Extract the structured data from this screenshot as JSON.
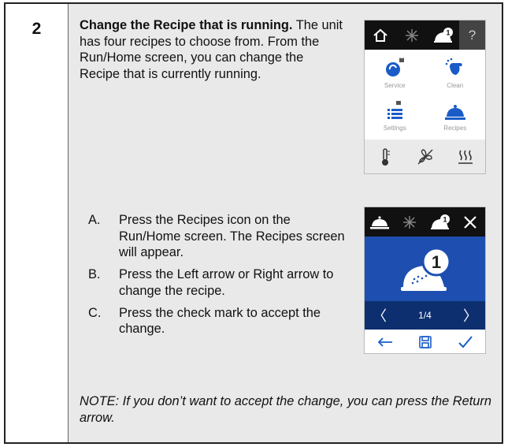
{
  "step_number": "2",
  "intro": {
    "title": "Change the Recipe that is running.",
    "body": " The unit has four recipes to choose from. From the Run/Home screen, you can change the Recipe that is currently running."
  },
  "steps": [
    {
      "letter": "A.",
      "text": "Press the Recipes icon on the Run/Home screen. The Recipes screen will appear."
    },
    {
      "letter": "B.",
      "text": "Press the Left arrow or Right arrow to change the recipe."
    },
    {
      "letter": "C.",
      "text": "Press the check mark to accept the change."
    }
  ],
  "note": "NOTE: If you don’t want to accept the change, you can press the Return arrow.",
  "home_screen": {
    "help_label": "?",
    "tiles": [
      {
        "label": "Service",
        "icon": "service-icon"
      },
      {
        "label": "Clean",
        "icon": "clean-icon"
      },
      {
        "label": "Settings",
        "icon": "settings-icon"
      },
      {
        "label": "Recipes",
        "icon": "recipes-icon"
      }
    ],
    "badge_number": "1"
  },
  "recipe_screen": {
    "recipe_number": "1",
    "page_indicator": "1/4",
    "left_arrow": "〈",
    "right_arrow": "〉"
  },
  "colors": {
    "screen_blue": "#1e4fb0",
    "screen_navy": "#0d2f70",
    "icon_blue": "#1a5bc8",
    "panel_gray": "#e9e9e9"
  }
}
